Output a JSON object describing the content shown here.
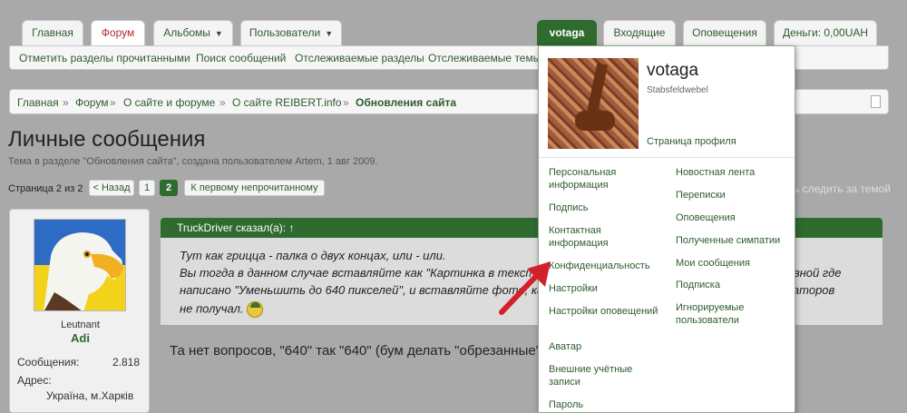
{
  "tabs": {
    "home": "Главная",
    "forum": "Форум",
    "albums": "Альбомы",
    "users": "Пользователи",
    "user": "votaga",
    "inbox": "Входящие",
    "alerts": "Оповещения",
    "money": "Деньги: 0,00UAH"
  },
  "subnav": {
    "mark_read": "Отметить разделы прочитанными",
    "search": "Поиск сообщений",
    "watched_forums": "Отслеживаемые разделы",
    "watched_threads": "Отслеживаемые темы"
  },
  "breadcrumb": {
    "items": [
      "Главная",
      "Форум",
      "О сайте и форуме",
      "О сайте REIBERT.info",
      "Обновления сайта"
    ],
    "separator": "»"
  },
  "thread": {
    "title": "Личные сообщения",
    "description": "Тема в разделе \"Обновления сайта\", создана пользователем Artem, 1 авг 2009."
  },
  "pagination": {
    "label": "Страница 2 из 2",
    "prev": "< Назад",
    "pages": [
      "1",
      "2"
    ],
    "current": "2",
    "first_unread": "К первому непрочитанному",
    "unwatch": "Перестать следить за темой"
  },
  "post": {
    "rank": "Leutnant",
    "username": "Adi",
    "messages_label": "Сообщения:",
    "messages_value": "2.818",
    "address_label": "Адрес:",
    "address_value": "Україна, м.Харків",
    "quote_header": "TruckDriver сказал(а): ↑",
    "quote_lines": [
      "Тут как грицца - палка о двух концах, или - или.",
      "Вы тогда в данном случае вставляйте как \"Картинка в тексте\", но не снимайте \"галочку\" на Радике на главной где",
      "написано \"Уменьшить до 640 пикселей\", и вставляйте фото, как я и делаю и ни одного замечания от модераторов",
      "не получал."
    ],
    "reply": "Та нет вопросов, \"640\" так \"640\" (бум делать \"обрезанные\"), раз Вы не против"
  },
  "popup": {
    "name": "votaga",
    "user_title": "Stabsfeldwebel",
    "profile_link": "Страница профиля",
    "left_items": [
      "Персональная информация",
      "Подпись",
      "Контактная информация",
      "Конфиденциальность",
      "Настройки",
      "Настройки оповещений",
      "Аватар",
      "Внешние учётные записи",
      "Пароль"
    ],
    "right_items": [
      "Новостная лента",
      "Переписки",
      "Оповещения",
      "Полученные симпатии",
      "Мои сообщения",
      "Подписка",
      "Игнорируемые пользователи"
    ]
  },
  "colors": {
    "accent_green": "#2f6a2f",
    "active_tab_red": "#b42a2a",
    "link_green": "#2e5c2e",
    "arrow_red": "#d4202a"
  }
}
